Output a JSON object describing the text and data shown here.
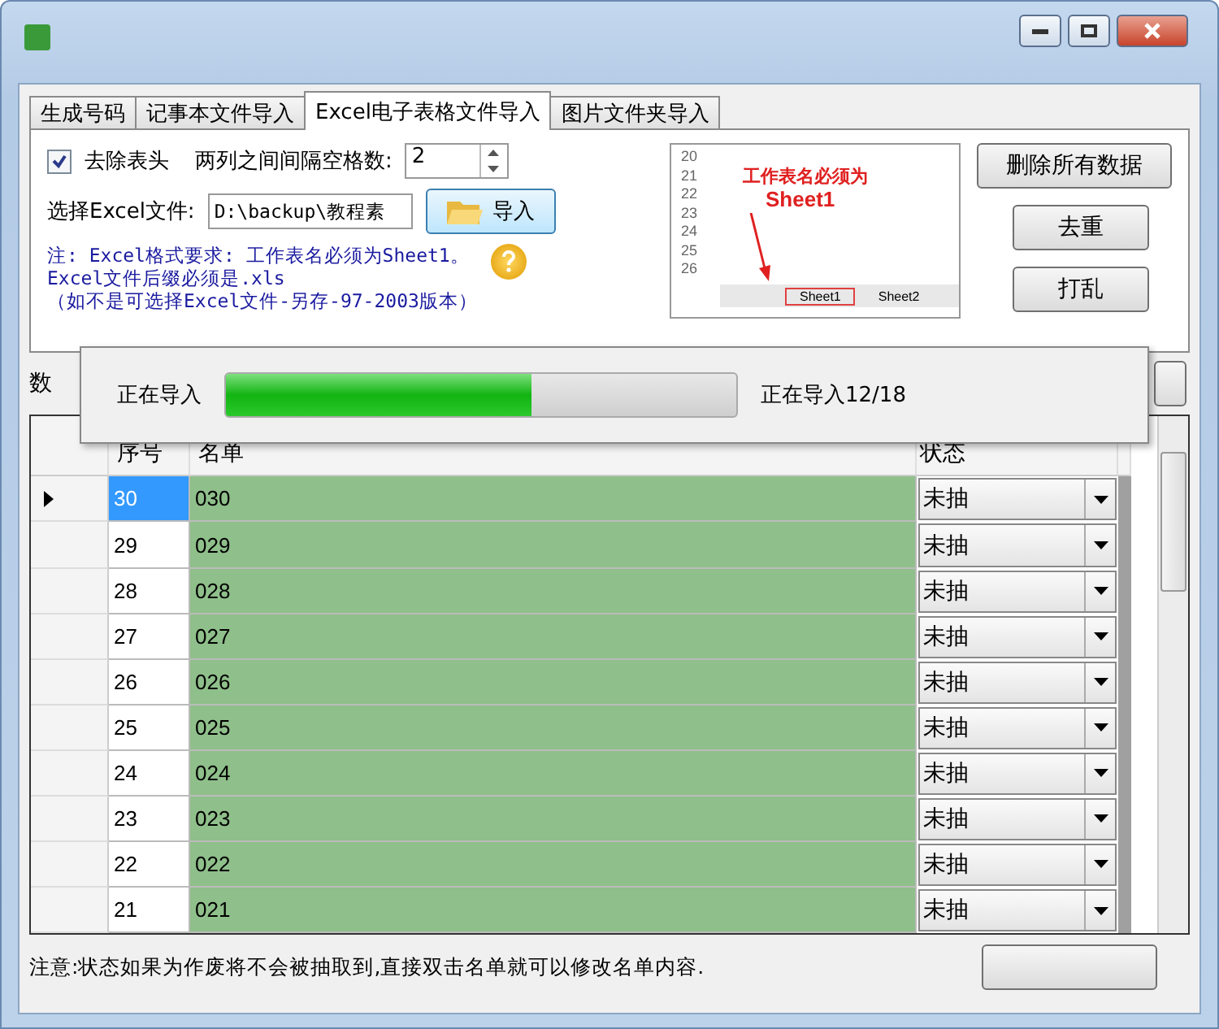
{
  "tabs": [
    {
      "label": "生成号码",
      "selected": false
    },
    {
      "label": "记事本文件导入",
      "selected": false
    },
    {
      "label": "Excel电子表格文件导入",
      "selected": true
    },
    {
      "label": "图片文件夹导入",
      "selected": false
    }
  ],
  "options": {
    "remove_header": {
      "label": "去除表头",
      "checked": true
    },
    "spacing_label": "两列之间间隔空格数:",
    "spacing_value": "2"
  },
  "file": {
    "label": "选择Excel文件:",
    "value": "D:\\backup\\教程素",
    "import_button": "导入"
  },
  "notes": [
    "注: Excel格式要求: 工作表名必须为Sheet1。",
    "Excel文件后缀必须是.xls",
    "（如不是可选择Excel文件-另存-97-2003版本）"
  ],
  "preview": {
    "caption": "工作表名必须为",
    "caption2": "Sheet1",
    "row_numbers": [
      "20",
      "21",
      "22",
      "23",
      "24",
      "25",
      "26"
    ],
    "sheet_tabs": [
      "Sheet1",
      "Sheet2"
    ]
  },
  "side_buttons": [
    "删除所有数据",
    "去重",
    "打乱"
  ],
  "data_label": "数",
  "progress": {
    "label": "正在导入",
    "level": 0.6,
    "reading": "正在导入12/18"
  },
  "table": {
    "columns": [
      "序号",
      "名单",
      "状态"
    ],
    "rows": [
      {
        "no": "30",
        "name": "030",
        "status": "未抽",
        "selected": true
      },
      {
        "no": "29",
        "name": "029",
        "status": "未抽",
        "selected": false
      },
      {
        "no": "28",
        "name": "028",
        "status": "未抽",
        "selected": false
      },
      {
        "no": "27",
        "name": "027",
        "status": "未抽",
        "selected": false
      },
      {
        "no": "26",
        "name": "026",
        "status": "未抽",
        "selected": false
      },
      {
        "no": "25",
        "name": "025",
        "status": "未抽",
        "selected": false
      },
      {
        "no": "24",
        "name": "024",
        "status": "未抽",
        "selected": false
      },
      {
        "no": "23",
        "name": "023",
        "status": "未抽",
        "selected": false
      },
      {
        "no": "22",
        "name": "022",
        "status": "未抽",
        "selected": false
      },
      {
        "no": "21",
        "name": "021",
        "status": "未抽",
        "selected": false
      }
    ]
  },
  "footer_note": "注意:状态如果为作废将不会被抽取到,直接双击名单就可以修改名单内容."
}
